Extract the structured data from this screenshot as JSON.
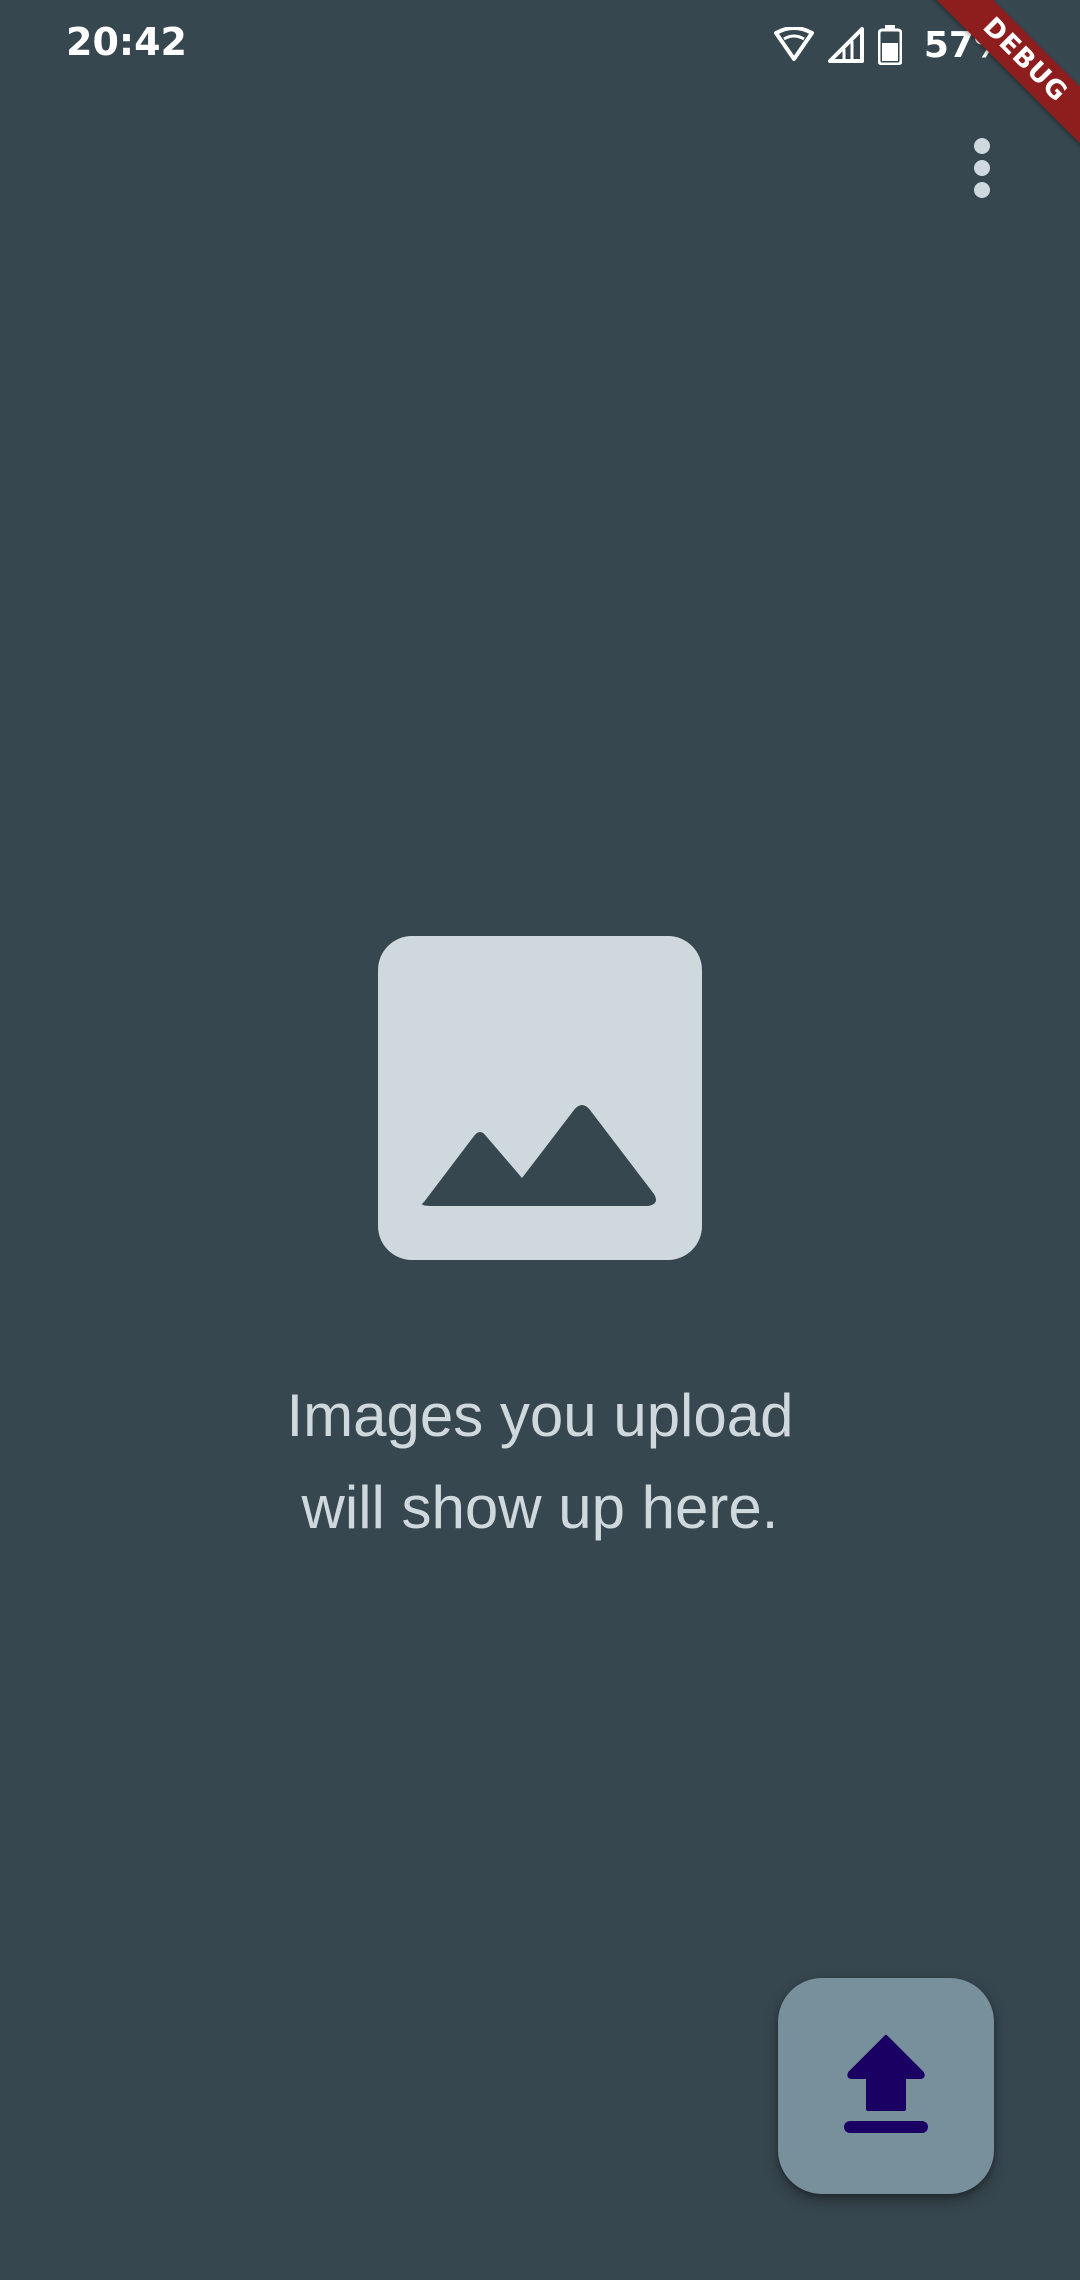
{
  "status_bar": {
    "time": "20:42",
    "battery_percent": "57%",
    "icons": [
      "wifi-icon",
      "cellular-signal-icon",
      "battery-icon"
    ]
  },
  "debug_banner": {
    "label": "DEBUG"
  },
  "app_bar": {
    "menu_icon": "more-vert-icon"
  },
  "empty_state": {
    "icon": "image-placeholder-icon",
    "message": "Images you upload will show up here."
  },
  "fab": {
    "icon": "upload-icon"
  },
  "colors": {
    "background": "#37474f",
    "icon_light": "#cfd8dc",
    "text": "#cfd8dc",
    "fab_background": "#78909c",
    "fab_icon": "#1a0063",
    "debug_ribbon": "#8e1d1d"
  }
}
